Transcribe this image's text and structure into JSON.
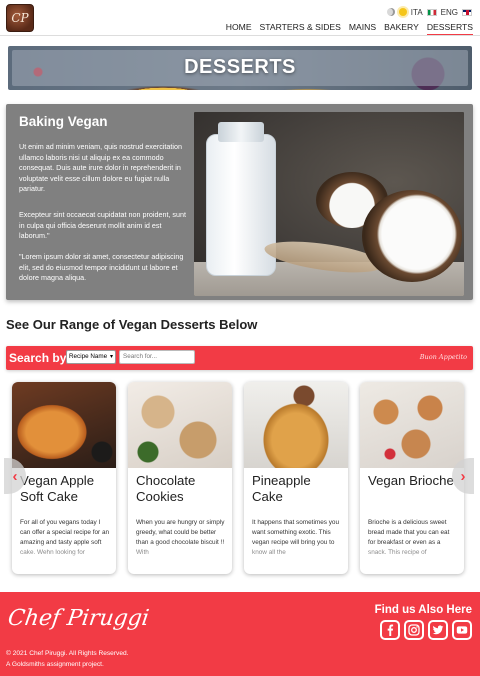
{
  "header": {
    "logo_text": "CP",
    "languages": {
      "it": "ITA",
      "en": "ENG"
    },
    "nav": [
      "HOME",
      "STARTERS & SIDES",
      "MAINS",
      "BAKERY",
      "DESSERTS"
    ],
    "active_nav": "DESSERTS"
  },
  "banner": {
    "title": "DESSERTS"
  },
  "intro": {
    "title": "Baking Vegan",
    "paragraphs": [
      "Ut enim ad minim veniam, quis nostrud exercitation ullamco laboris nisi ut aliquip ex ea commodo consequat. Duis aute irure dolor in reprehenderit in voluptate velit esse cillum dolore eu fugiat nulla pariatur.",
      "Excepteur sint occaecat cupidatat non proident, sunt in culpa qui officia deserunt mollit anim id est laborum.\"",
      "\"Lorem ipsum dolor sit amet, consectetur adipiscing elit, sed do eiusmod tempor incididunt ut labore et dolore magna aliqua."
    ]
  },
  "range": {
    "title": "See Our Range of Vegan Desserts Below"
  },
  "search": {
    "label": "Search by",
    "select_value": "Recipe Name",
    "placeholder": "Search for...",
    "tagline": "Buon Appetito"
  },
  "cards": [
    {
      "title": "Vegan Apple Soft Cake",
      "text": "For all of you vegans today I can offer a special recipe for an amazing and tasty apple soft cake. Wehn looking for"
    },
    {
      "title": "Chocolate Cookies",
      "text": "When you are hungry or simply greedy, what could be better than a good chocolate biscuit !! With"
    },
    {
      "title": "Pineapple Cake",
      "text": "It happens that sometimes you want something exotic. This vegan recipe will bring you to know all the"
    },
    {
      "title": "Vegan Brioche",
      "text": "Brioche is a delicious sweet bread made that you can eat for breakfast or even as a snack. This recipe of"
    }
  ],
  "carousel": {
    "prev": "‹",
    "next": "›"
  },
  "footer": {
    "signature": "Chef Piruggi",
    "copyright_lines": [
      "© 2021 Chef Piruggi. All Rights Reserved.",
      "A Goldsmiths assignment project."
    ],
    "find_us": "Find us Also Here",
    "socials": [
      "facebook-icon",
      "instagram-icon",
      "twitter-icon",
      "youtube-icon"
    ]
  },
  "colors": {
    "accent": "#f23b45",
    "intro_bg": "#808080"
  }
}
